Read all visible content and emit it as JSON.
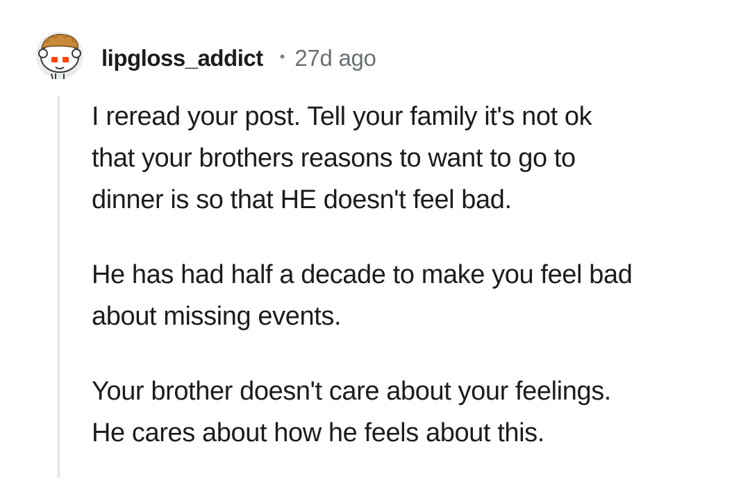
{
  "comment": {
    "username": "lipgloss_addict",
    "separator": "•",
    "timestamp": "27d ago",
    "avatar_icon": "snoo-avatar-icon",
    "paragraphs": [
      "I reread your post.  Tell your family it's not ok\nthat your brothers reasons to want to go to\ndinner is so that HE doesn't feel bad.",
      "He has had half a decade to make you feel bad\nabout missing events.",
      "Your brother doesn't care about your feelings.\nHe cares about how he feels about this."
    ]
  },
  "colors": {
    "text": "#1c1c1c",
    "meta": "#6a7074",
    "thread_line": "#e2e4e5",
    "avatar_bg": "#e9eced",
    "avatar_hair": "#c98a3a",
    "avatar_eyes": "#ff4500"
  }
}
